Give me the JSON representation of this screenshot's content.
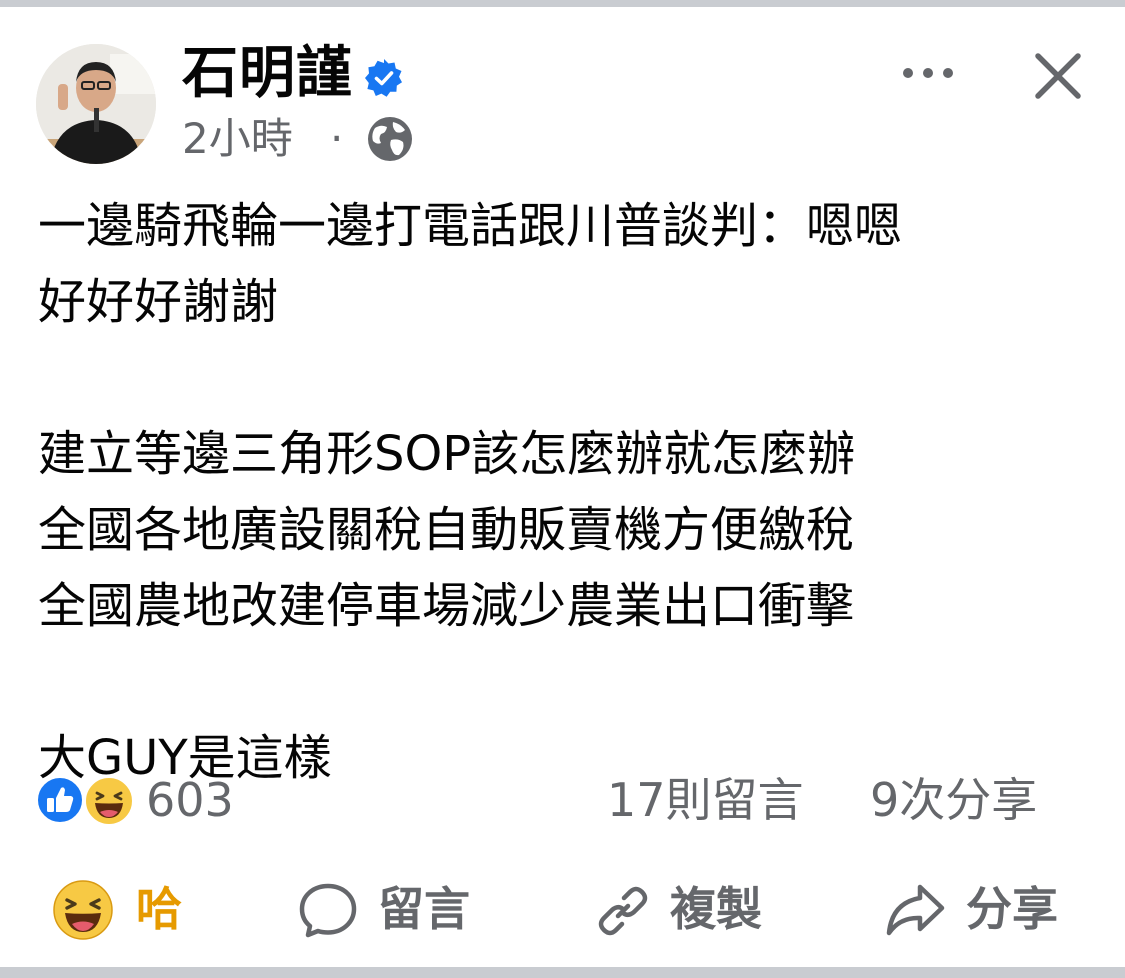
{
  "post": {
    "author": "石明謹",
    "time": "2小時",
    "separator": "·",
    "body_lines": [
      "一邊騎飛輪一邊打電話跟川普談判：嗯嗯",
      "好好好謝謝",
      "",
      "建立等邊三角形SOP該怎麼辦就怎麼辦",
      "全國各地廣設關稅自動販賣機方便繳稅",
      "全國農地改建停車場減少農業出口衝擊",
      "",
      "大GUY是這樣"
    ]
  },
  "stats": {
    "reaction_count": "603",
    "comments": "17則留言",
    "shares": "9次分享"
  },
  "actions": {
    "haha": "哈",
    "comment": "留言",
    "copy": "複製",
    "share": "分享"
  },
  "icons": {
    "verified": "verified-badge-icon",
    "audience": "globe-icon",
    "more": "more-icon",
    "close": "close-icon",
    "like_reaction": "like-reaction-icon",
    "haha_reaction": "haha-reaction-icon",
    "comment": "comment-icon",
    "copy": "link-icon",
    "share": "share-icon"
  },
  "colors": {
    "text_primary": "#050505",
    "text_secondary": "#65676b",
    "verified_blue": "#1877f2",
    "haha_orange": "#e69a00",
    "divider": "#c9ccd1"
  }
}
